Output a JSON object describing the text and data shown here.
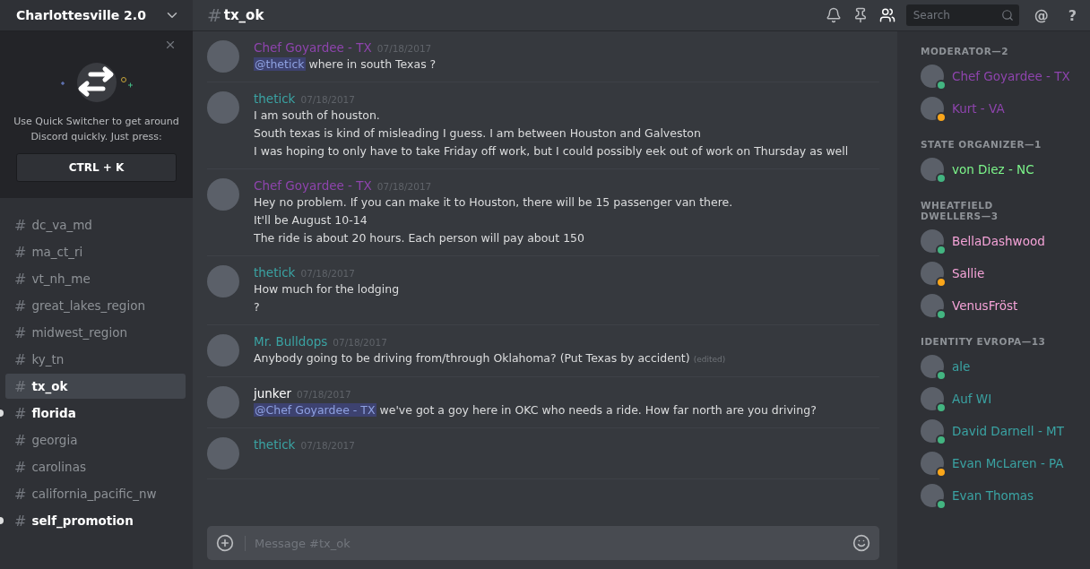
{
  "server": {
    "name": "Charlottesville 2.0"
  },
  "quick_switcher": {
    "text": "Use Quick Switcher to get around Discord quickly. Just press:",
    "shortcut": "CTRL + K"
  },
  "channels": [
    {
      "name": "dc_va_md",
      "selected": false,
      "unread": false
    },
    {
      "name": "ma_ct_ri",
      "selected": false,
      "unread": false
    },
    {
      "name": "vt_nh_me",
      "selected": false,
      "unread": false
    },
    {
      "name": "great_lakes_region",
      "selected": false,
      "unread": false
    },
    {
      "name": "midwest_region",
      "selected": false,
      "unread": false
    },
    {
      "name": "ky_tn",
      "selected": false,
      "unread": false
    },
    {
      "name": "tx_ok",
      "selected": true,
      "unread": false
    },
    {
      "name": "florida",
      "selected": false,
      "unread": true
    },
    {
      "name": "georgia",
      "selected": false,
      "unread": false
    },
    {
      "name": "carolinas",
      "selected": false,
      "unread": false
    },
    {
      "name": "california_pacific_nw",
      "selected": false,
      "unread": false
    },
    {
      "name": "self_promotion",
      "selected": false,
      "unread": true
    }
  ],
  "header": {
    "hash": "#",
    "channel": "tx_ok",
    "search": {
      "placeholder": "Search"
    },
    "mention_icon": "@",
    "help_icon": "?"
  },
  "messages": [
    {
      "author": "Chef Goyardee - TX",
      "color": "#8e44ad",
      "time": "07/18/2017",
      "lines": [
        {
          "mention": "@thetick",
          "text": " where in south Texas ?"
        }
      ]
    },
    {
      "author": "thetick",
      "color": "#3aa3a3",
      "time": "07/18/2017",
      "lines": [
        {
          "text": "I am south of houston."
        },
        {
          "text": "South texas is kind of misleading I guess. I am between Houston and Galveston"
        },
        {
          "text": "I was hoping to only have to take Friday off work, but I could possibly eek out of work on Thursday as well"
        }
      ]
    },
    {
      "author": "Chef Goyardee - TX",
      "color": "#8e44ad",
      "time": "07/18/2017",
      "lines": [
        {
          "text": "Hey no problem. If you can make it to Houston, there will be 15 passenger van there."
        },
        {
          "text": "It'll be August 10-14"
        },
        {
          "text": "The ride is about 20 hours. Each person will pay about 150"
        }
      ]
    },
    {
      "author": "thetick",
      "color": "#3aa3a3",
      "time": "07/18/2017",
      "lines": [
        {
          "text": "How much for the lodging"
        },
        {
          "text": "?"
        }
      ]
    },
    {
      "author": "Mr. Bulldops",
      "color": "#3aa3a3",
      "time": "07/18/2017",
      "lines": [
        {
          "text": "Anybody going to be driving from/through Oklahoma? (Put Texas by accident)",
          "edited": "(edited)"
        }
      ]
    },
    {
      "author": "junker",
      "color": "#ffffff",
      "time": "07/18/2017",
      "lines": [
        {
          "mention": "@Chef Goyardee - TX",
          "text": " we've got a goy here in OKC who needs a ride. How far north are you driving?"
        }
      ]
    },
    {
      "author": "thetick",
      "color": "#3aa3a3",
      "time": "07/18/2017"
    }
  ],
  "composer": {
    "placeholder": "Message #tx_ok"
  },
  "member_groups": [
    {
      "title": "MODERATOR—2",
      "members": [
        {
          "name": "Chef Goyardee - TX",
          "color": "#8e44ad",
          "idle": false
        },
        {
          "name": "Kurt - VA",
          "color": "#8e44ad",
          "idle": true
        }
      ]
    },
    {
      "title": "STATE ORGANIZER—1",
      "members": [
        {
          "name": "von Diez - NC",
          "color": "#7cf58a",
          "idle": false
        }
      ]
    },
    {
      "title": "WHEATFIELD DWELLERS—3",
      "members": [
        {
          "name": "BellaDashwood",
          "color": "#f5a3d8",
          "idle": false
        },
        {
          "name": "Sallie",
          "color": "#f5a3d8",
          "idle": true
        },
        {
          "name": "VenusFröst",
          "color": "#f5a3d8",
          "idle": false
        }
      ]
    },
    {
      "title": "IDENTITY EVROPA—13",
      "members": [
        {
          "name": "ale",
          "color": "#3aa3a3",
          "idle": false
        },
        {
          "name": "Auf WI",
          "color": "#3aa3a3",
          "idle": false
        },
        {
          "name": "David Darnell - MT",
          "color": "#3aa3a3",
          "idle": false
        },
        {
          "name": "Evan McLaren - PA",
          "color": "#3aa3a3",
          "idle": true
        },
        {
          "name": "Evan Thomas",
          "color": "#3aa3a3",
          "idle": false
        }
      ]
    }
  ]
}
